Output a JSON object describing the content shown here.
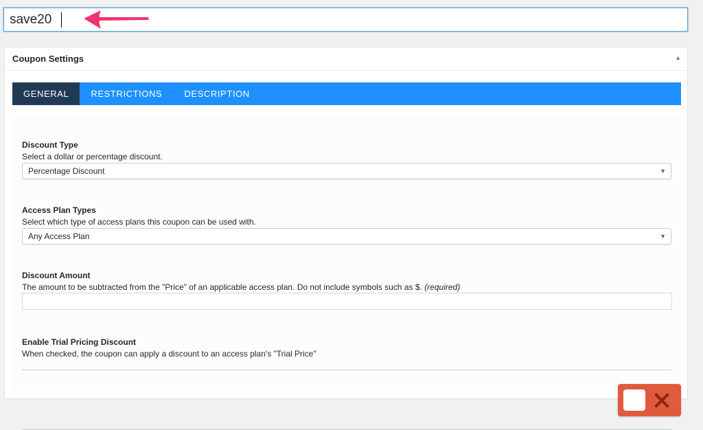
{
  "post_title": {
    "value": "save20"
  },
  "coupon_settings": {
    "title": "Coupon Settings",
    "tabs": [
      {
        "label": "GENERAL",
        "active": true
      },
      {
        "label": "RESTRICTIONS",
        "active": false
      },
      {
        "label": "DESCRIPTION",
        "active": false
      }
    ],
    "fields": {
      "discount_type": {
        "title": "Discount Type",
        "description": "Select a dollar or percentage discount.",
        "selected": "Percentage Discount"
      },
      "access_plan_types": {
        "title": "Access Plan Types",
        "description": "Select which type of access plans this coupon can be used with.",
        "selected": "Any Access Plan"
      },
      "discount_amount": {
        "title": "Discount Amount",
        "description": "The amount to be subtracted from the \"Price\" of an applicable access plan. Do not include symbols such as $.",
        "required_note": "(required)",
        "value": ""
      },
      "trial_discount": {
        "title": "Enable Trial Pricing Discount",
        "description": "When checked, the coupon can apply a discount to an access plan's \"Trial Price\"",
        "enabled": false
      }
    }
  },
  "colors": {
    "tab_bar": "#1e90ff",
    "tab_active": "#1f3a55",
    "toggle_off": "#e05a3c",
    "annotation_arrow": "#f0346e"
  },
  "icons": {
    "collapse": "triangle-up-icon",
    "select_arrow": "triangle-down-icon",
    "toggle_off": "x-icon",
    "annotation": "arrow-left-icon"
  }
}
